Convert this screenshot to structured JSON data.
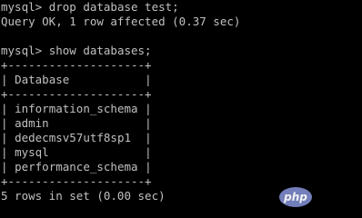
{
  "colors": {
    "background": "#000000",
    "text": "#c0c0c0",
    "watermark_bg": "#7a86c6"
  },
  "session": [
    {
      "kind": "prompt",
      "prompt": "mysql>",
      "command": "drop database test;"
    },
    {
      "kind": "output",
      "text": "Query OK, 1 row affected (0.37 sec)"
    },
    {
      "kind": "blank"
    },
    {
      "kind": "prompt",
      "prompt": "mysql>",
      "command": "show databases;"
    }
  ],
  "table": {
    "border": "+--------------------+",
    "header": "Database",
    "rows": [
      "information_schema",
      "admin",
      "dedecmsv57utf8sp1",
      "mysql",
      "performance_schema"
    ]
  },
  "summary": "5 rows in set (0.00 sec)",
  "watermark": {
    "text": "php"
  }
}
